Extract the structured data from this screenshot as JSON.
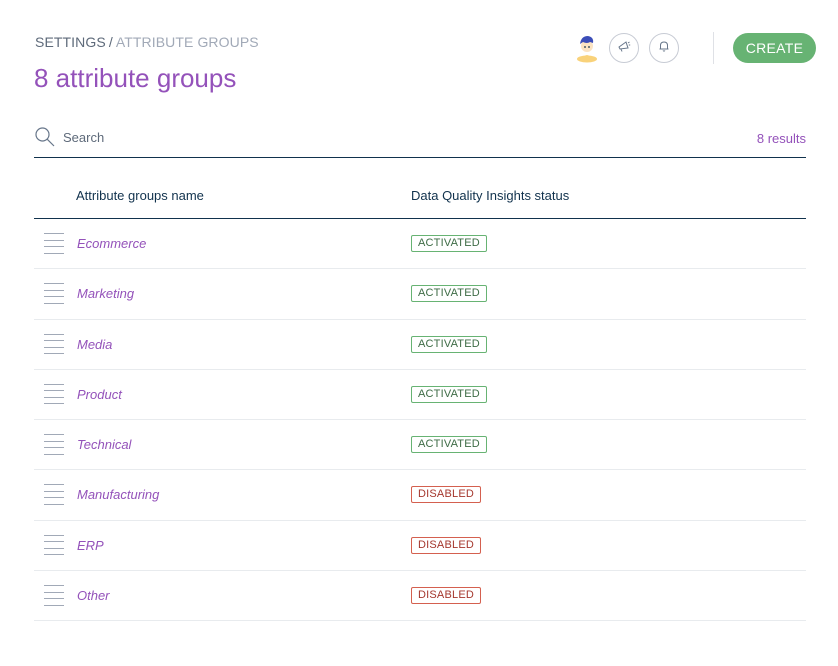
{
  "breadcrumb": {
    "root": "SETTINGS",
    "separator": "/",
    "current": "ATTRIBUTE GROUPS"
  },
  "page": {
    "title": "8 attribute groups"
  },
  "header": {
    "create_label": "CREATE",
    "icons": [
      "user-avatar",
      "announcements-icon",
      "notifications-bell-icon"
    ]
  },
  "search": {
    "placeholder": "Search",
    "value": "",
    "results": "8 results"
  },
  "table": {
    "columns": [
      "Attribute groups name",
      "Data Quality Insights status"
    ],
    "rows": [
      {
        "name": "Ecommerce",
        "status": "ACTIVATED",
        "state": "activated"
      },
      {
        "name": "Marketing",
        "status": "ACTIVATED",
        "state": "activated"
      },
      {
        "name": "Media",
        "status": "ACTIVATED",
        "state": "activated"
      },
      {
        "name": "Product",
        "status": "ACTIVATED",
        "state": "activated"
      },
      {
        "name": "Technical",
        "status": "ACTIVATED",
        "state": "activated"
      },
      {
        "name": "Manufacturing",
        "status": "DISABLED",
        "state": "disabled"
      },
      {
        "name": "ERP",
        "status": "DISABLED",
        "state": "disabled"
      },
      {
        "name": "Other",
        "status": "DISABLED",
        "state": "disabled"
      }
    ]
  },
  "colors": {
    "brand_purple": "#9452ba",
    "create_green": "#67b373",
    "activated": "#67b373",
    "disabled": "#d4604f",
    "text_dark": "#11324d"
  }
}
